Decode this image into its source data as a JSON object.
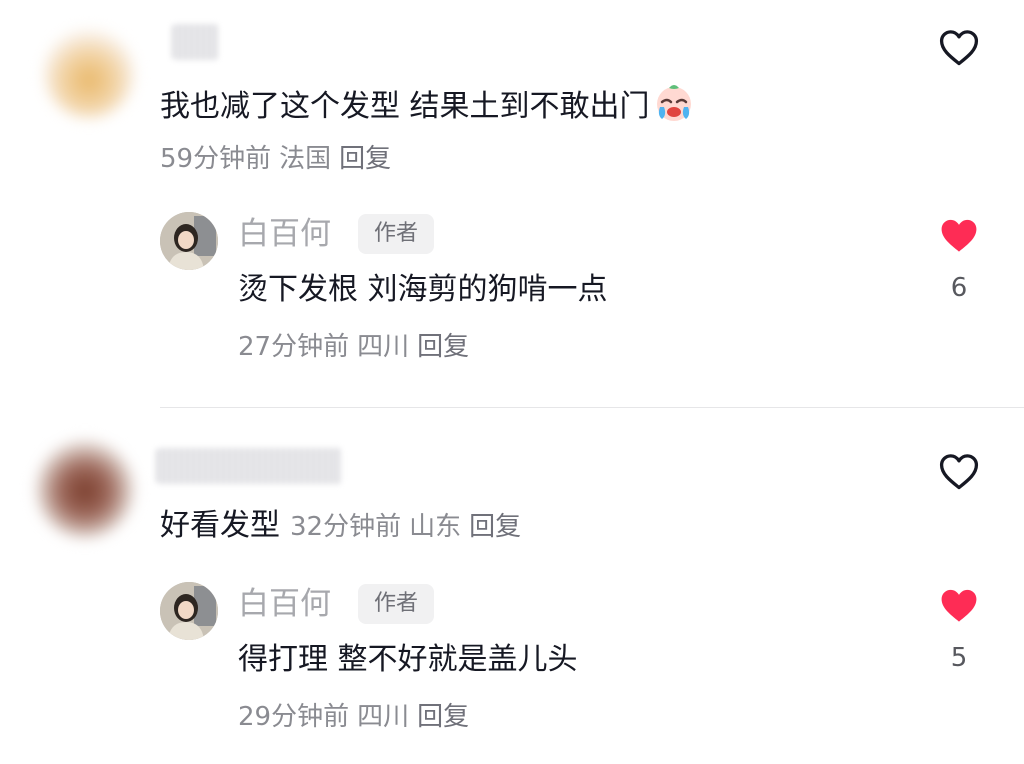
{
  "comments": [
    {
      "text": "我也减了这个发型 结果土到不敢出门",
      "emoji": "crying-face-emoji",
      "time": "59分钟前",
      "location": "法国",
      "reply_label": "回复",
      "liked": false,
      "reply": {
        "author": "白百何",
        "badge": "作者",
        "text": "烫下发根 刘海剪的狗啃一点",
        "time": "27分钟前",
        "location": "四川",
        "reply_label": "回复",
        "liked": true,
        "likes": "6"
      }
    },
    {
      "text": "好看发型",
      "time": "32分钟前",
      "location": "山东",
      "reply_label": "回复",
      "liked": false,
      "reply": {
        "author": "白百何",
        "badge": "作者",
        "text": "得打理 整不好就是盖儿头",
        "time": "29分钟前",
        "location": "四川",
        "reply_label": "回复",
        "liked": true,
        "likes": "5"
      }
    }
  ],
  "colors": {
    "like_active": "#fe2c55",
    "like_inactive": "#161823",
    "meta_text": "#8a8b91"
  }
}
